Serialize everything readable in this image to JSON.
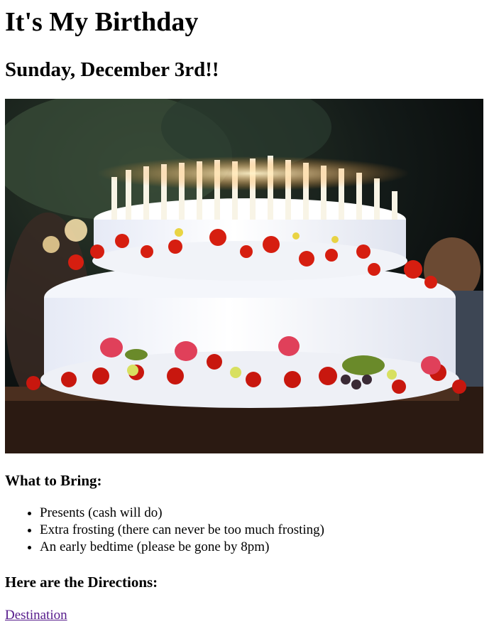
{
  "page": {
    "title": "It's My Birthday",
    "date": "Sunday, December 3rd!!",
    "bring_heading": "What to Bring:",
    "bring_items": [
      "Presents (cash will do)",
      "Extra frosting (there can never be too much frosting)",
      "An early bedtime (please be gone by 8pm)"
    ],
    "directions_heading": "Here are the Directions:",
    "directions_link": "Destination"
  },
  "colors": {
    "link_visited": "#551a8b"
  },
  "icons": {
    "hero_image": "birthday-cake-photo"
  }
}
